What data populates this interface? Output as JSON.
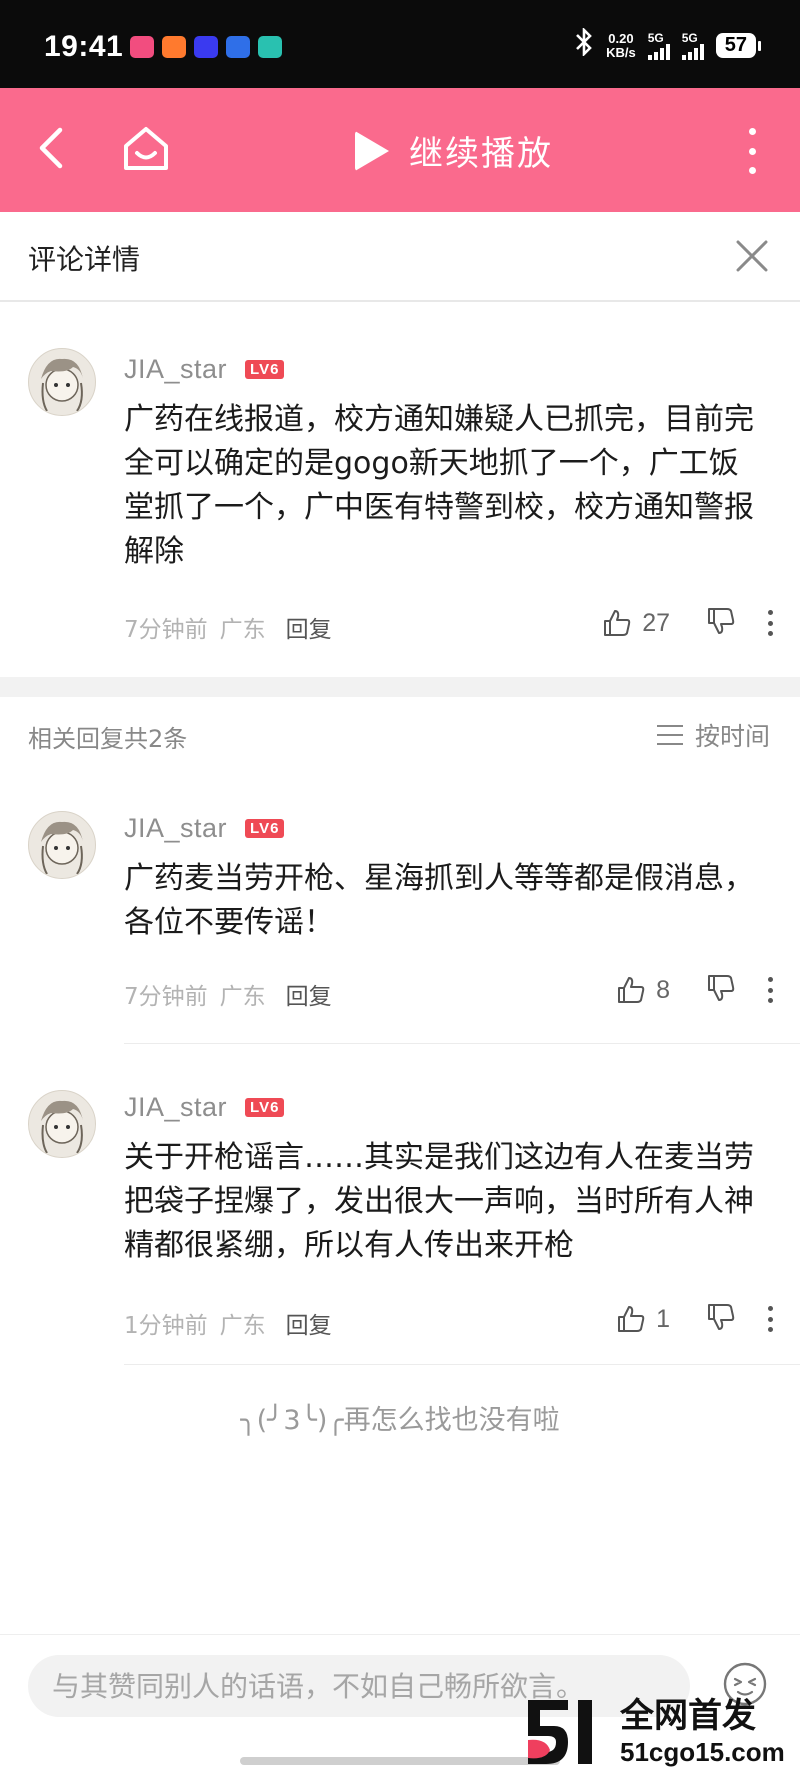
{
  "status_bar": {
    "time": "19:41",
    "net_speed_value": "0.20",
    "net_speed_unit": "KB/s",
    "sim1_label": "5G",
    "sim2_label": "5G",
    "battery": "57",
    "app_icon_colors": [
      "#f24d7f",
      "#ff7a2e",
      "#3a3af0",
      "#2f6fe8",
      "#29c1b0"
    ]
  },
  "header": {
    "title": "继续播放",
    "accent_color": "#fa6a8d"
  },
  "panel": {
    "title": "评论详情"
  },
  "main_comment": {
    "username": "JIA_star",
    "level": "LV6",
    "text": "广药在线报道，校方通知嫌疑人已抓完，目前完全可以确定的是gogo新天地抓了一个，广工饭堂抓了一个，广中医有特警到校，校方通知警报解除",
    "time": "7分钟前",
    "location": "广东",
    "reply_label": "回复",
    "likes": "27"
  },
  "replies_header": {
    "count_text": "相关回复共2条",
    "sort_label": "按时间"
  },
  "replies": [
    {
      "username": "JIA_star",
      "level": "LV6",
      "text": "广药麦当劳开枪、星海抓到人等等都是假消息，各位不要传谣！",
      "time": "7分钟前",
      "location": "广东",
      "reply_label": "回复",
      "likes": "8"
    },
    {
      "username": "JIA_star",
      "level": "LV6",
      "text": "关于开枪谣言……其实是我们这边有人在麦当劳把袋子捏爆了，发出很大一声响，当时所有人神精都很紧绷，所以有人传出来开枪",
      "time": "1分钟前",
      "location": "广东",
      "reply_label": "回复",
      "likes": "1"
    }
  ],
  "end_message": "╮(╯3╰)╭再怎么找也没有啦",
  "input": {
    "placeholder": "与其赞同别人的话语，不如自己畅所欲言。"
  },
  "watermark": {
    "text": "全网首发",
    "url": "51cgo15.com"
  }
}
